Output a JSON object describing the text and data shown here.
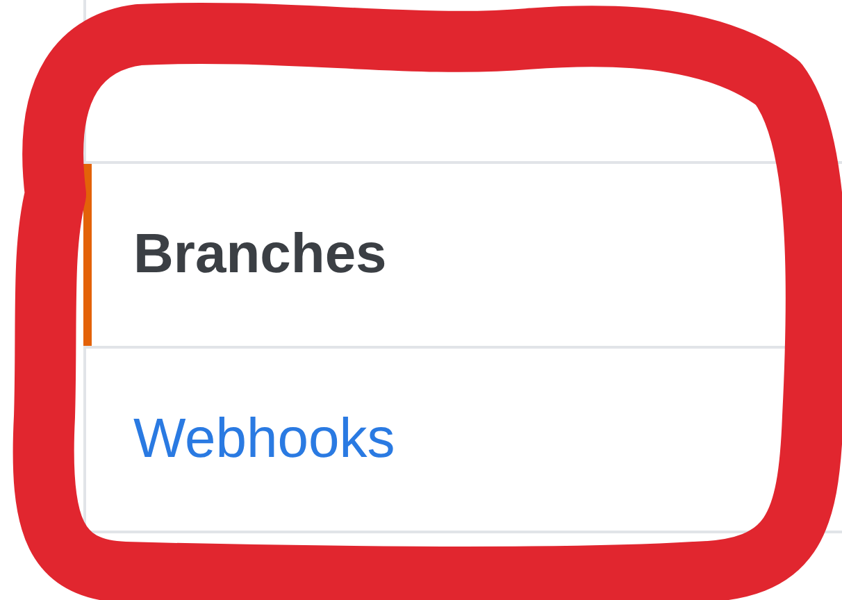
{
  "sidebar": {
    "items": [
      {
        "label": "Branches",
        "selected": true
      },
      {
        "label": "Webhooks",
        "selected": false
      }
    ]
  }
}
